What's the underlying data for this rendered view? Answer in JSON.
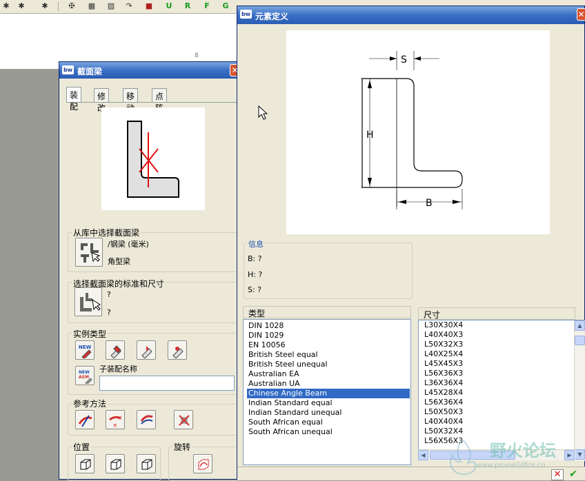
{
  "toolbar": {
    "glyphs": [
      "✱",
      "✱",
      "✱",
      "✠",
      "▦",
      "▨",
      "↷",
      "■",
      "U",
      "R",
      "F",
      "G"
    ]
  },
  "workspace": {
    "marker": "8"
  },
  "beam_panel": {
    "title": "截面梁",
    "logo": "bw",
    "tabs": [
      "装配",
      "修改",
      "移动",
      "点阵列"
    ],
    "library_group": {
      "title": "从库中选择截面梁",
      "path": "/钢梁 (毫米)",
      "type": "角型梁"
    },
    "standard_group": {
      "title": "选择截面梁的标准和尺寸",
      "standard_value": "?",
      "size_value": "?"
    },
    "instance_group": {
      "title": "实例类型",
      "sub_assembly_label": "子装配名称",
      "sub_assembly_value": "",
      "new_label": "NEW",
      "asm_label": "ASM"
    },
    "reference_group": {
      "title": "参考方法"
    },
    "position_group": {
      "title": "位置"
    },
    "rotation_group": {
      "title": "旋转"
    }
  },
  "element_window": {
    "title": "元素定义",
    "logo": "bw",
    "dimensions": {
      "s": "S",
      "h": "H",
      "b": "B"
    },
    "info": {
      "title": "信息",
      "b_line": "B: ?",
      "h_line": "H: ?",
      "s_line": "S: ?"
    },
    "type_list": {
      "header": "类型",
      "items": [
        "DIN 1028",
        "DIN 1029",
        "EN 10056",
        "British Steel equal",
        "British Steel unequal",
        "Australian EA",
        "Australian UA",
        "Chinese Angle Beam",
        "Indian Standard equal",
        "Indian Standard unequal",
        "South African equal",
        "South African unequal"
      ],
      "selected": "Chinese Angle Beam"
    },
    "size_list": {
      "header": "尺寸",
      "items": [
        "L30X30X4",
        "L40X40X3",
        "L50X32X3",
        "L40X25X4",
        "L45X45X3",
        "L56X36X3",
        "L36X36X4",
        "L45X28X4",
        "L56X36X4",
        "L50X50X3",
        "L40X40X4",
        "L50X32X4",
        "L56X56X3"
      ]
    },
    "cancel_glyph": "✕",
    "ok_glyph": "✔"
  },
  "watermark": {
    "text": "野火论坛",
    "url": "www.proewildfire.cn"
  },
  "colors": {
    "titlebar": "#2a5cb3",
    "selection": "#316ac5",
    "info_title": "#1a4fb0",
    "dialog_bg": "#ece9d8",
    "workspace_bg": "#9a9a94"
  }
}
